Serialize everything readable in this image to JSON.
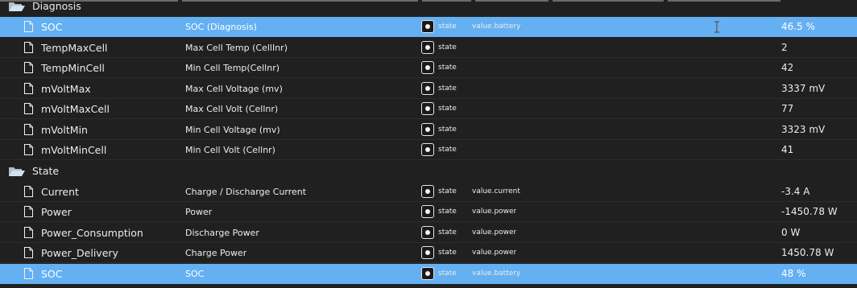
{
  "header": {
    "folder_label": "Diagnosis"
  },
  "diagnosis": {
    "label": "Diagnosis",
    "rows": [
      {
        "name": "SOC",
        "desc": "SOC (Diagnosis)",
        "type": "state",
        "role": "value.battery",
        "value": "46.5 %"
      },
      {
        "name": "TempMaxCell",
        "desc": "Max Cell Temp (CellInr)",
        "type": "state",
        "role": "",
        "value": "2"
      },
      {
        "name": "TempMinCell",
        "desc": "Min Cell Temp(Cellnr)",
        "type": "state",
        "role": "",
        "value": "42"
      },
      {
        "name": "mVoltMax",
        "desc": "Max Cell Voltage (mv)",
        "type": "state",
        "role": "",
        "value": "3337 mV"
      },
      {
        "name": "mVoltMaxCell",
        "desc": "Max Cell Volt (Cellnr)",
        "type": "state",
        "role": "",
        "value": "77"
      },
      {
        "name": "mVoltMin",
        "desc": "Min Cell Voltage (mv)",
        "type": "state",
        "role": "",
        "value": "3323 mV"
      },
      {
        "name": "mVoltMinCell",
        "desc": "Min Cell Volt (Cellnr)",
        "type": "state",
        "role": "",
        "value": "41"
      }
    ]
  },
  "state": {
    "label": "State",
    "rows": [
      {
        "name": "Current",
        "desc": "Charge / Discharge Current",
        "type": "state",
        "role": "value.current",
        "value": "-3.4 A"
      },
      {
        "name": "Power",
        "desc": "Power",
        "type": "state",
        "role": "value.power",
        "value": "-1450.78 W"
      },
      {
        "name": "Power_Consumption",
        "desc": "Discharge Power",
        "type": "state",
        "role": "value.power",
        "value": "0 W"
      },
      {
        "name": "Power_Delivery",
        "desc": "Charge Power",
        "type": "state",
        "role": "value.power",
        "value": "1450.78 W"
      },
      {
        "name": "SOC",
        "desc": "SOC",
        "type": "state",
        "role": "value.battery",
        "value": "48 %"
      }
    ]
  },
  "colors": {
    "background": "#202020",
    "selected_row": "#64b0f2",
    "text": "#ececec"
  },
  "icons": {
    "folder": "folder-open-icon",
    "file": "file-icon",
    "type": "state-type-icon",
    "cursor": "text-cursor-icon"
  }
}
